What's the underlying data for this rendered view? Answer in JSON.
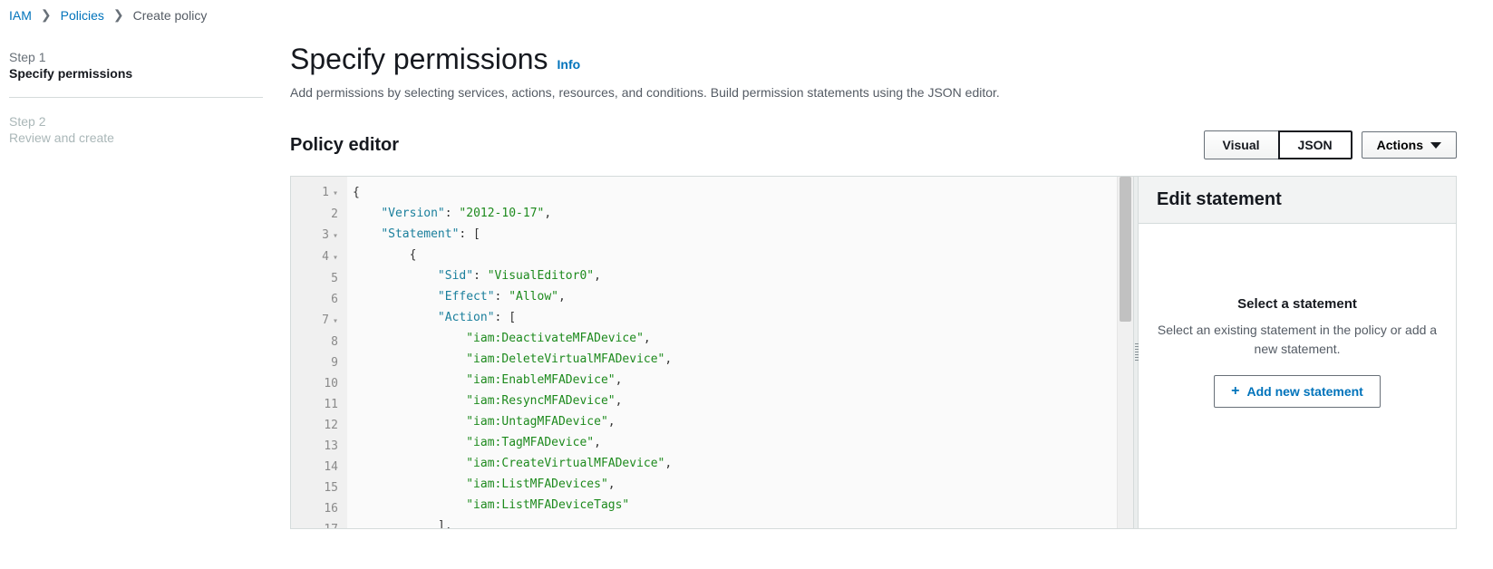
{
  "breadcrumb": {
    "root": "IAM",
    "mid": "Policies",
    "current": "Create policy"
  },
  "sidebar": {
    "step1_num": "Step 1",
    "step1_label": "Specify permissions",
    "step2_num": "Step 2",
    "step2_label": "Review and create"
  },
  "header": {
    "title": "Specify permissions",
    "info": "Info",
    "desc": "Add permissions by selecting services, actions, resources, and conditions. Build permission statements using the JSON editor."
  },
  "editor": {
    "title": "Policy editor",
    "tab_visual": "Visual",
    "tab_json": "JSON",
    "actions": "Actions"
  },
  "code": {
    "l1": "{",
    "l2_k": "\"Version\"",
    "l2_v": "\"2012-10-17\"",
    "l3_k": "\"Statement\"",
    "l5_k": "\"Sid\"",
    "l5_v": "\"VisualEditor0\"",
    "l6_k": "\"Effect\"",
    "l6_v": "\"Allow\"",
    "l7_k": "\"Action\"",
    "a1": "\"iam:DeactivateMFADevice\"",
    "a2": "\"iam:DeleteVirtualMFADevice\"",
    "a3": "\"iam:EnableMFADevice\"",
    "a4": "\"iam:ResyncMFADevice\"",
    "a5": "\"iam:UntagMFADevice\"",
    "a6": "\"iam:TagMFADevice\"",
    "a7": "\"iam:CreateVirtualMFADevice\"",
    "a8": "\"iam:ListMFADevices\"",
    "a9": "\"iam:ListMFADeviceTags\""
  },
  "panel": {
    "header": "Edit statement",
    "title": "Select a statement",
    "desc": "Select an existing statement in the policy or add a new statement.",
    "add": "Add new statement"
  }
}
